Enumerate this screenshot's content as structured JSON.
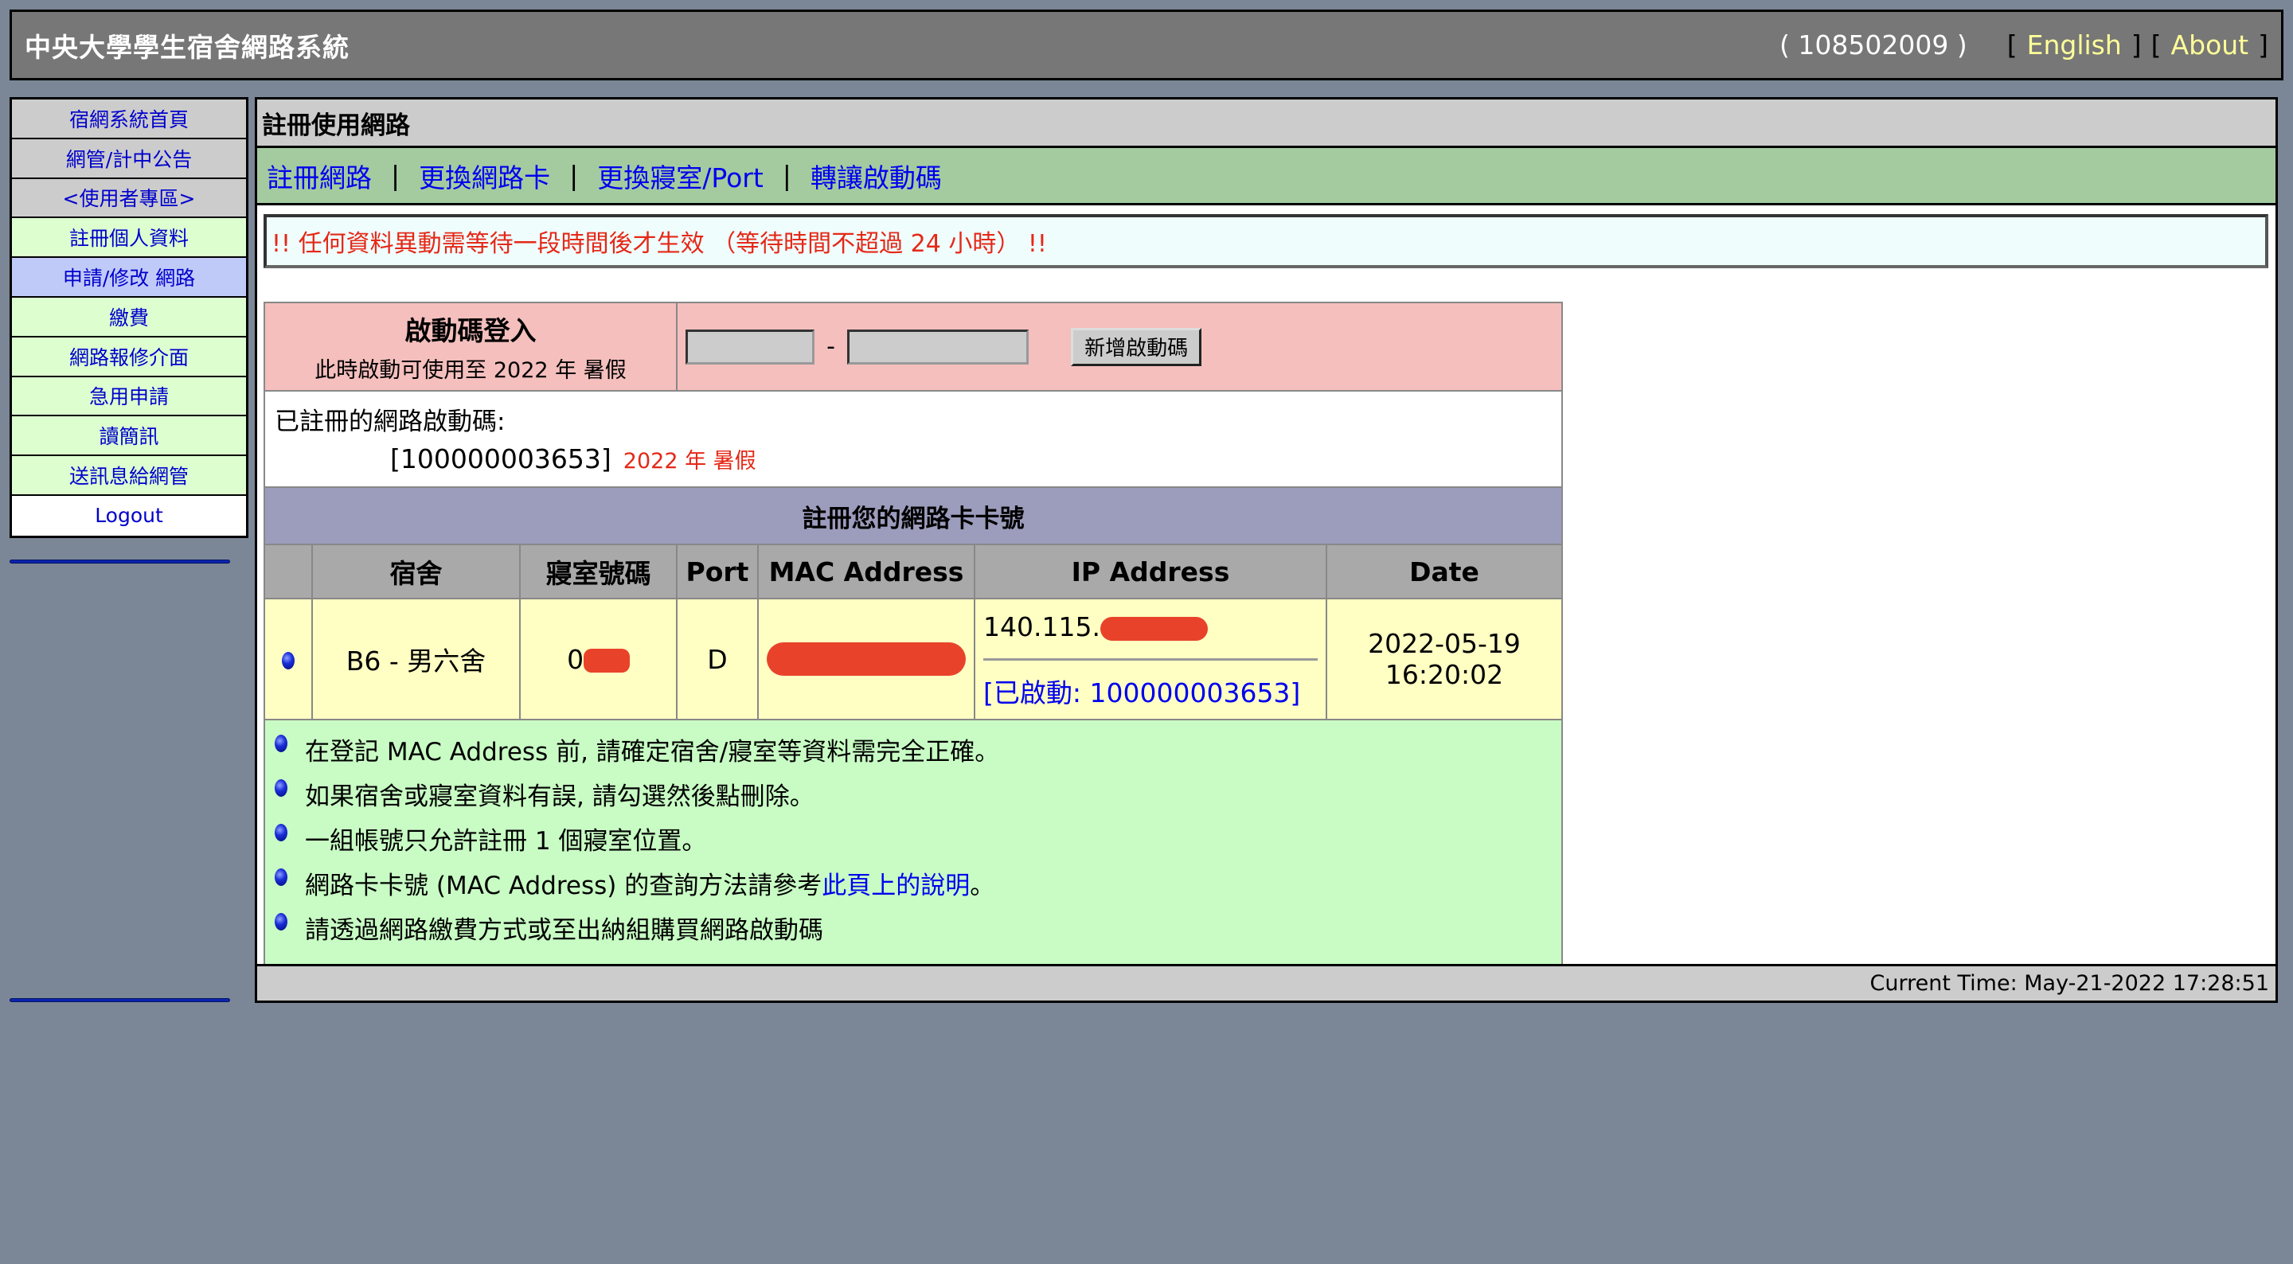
{
  "header": {
    "title": "中央大學學生宿舍網路系統",
    "user_id": "( 108502009 )",
    "links": [
      {
        "label": "English"
      },
      {
        "label": "About"
      }
    ]
  },
  "sidebar": {
    "items": [
      {
        "label": "宿網系統首頁",
        "style": "gray"
      },
      {
        "label": "網管/計中公告",
        "style": "gray"
      },
      {
        "label": "<使用者專區>",
        "style": "gray"
      },
      {
        "label": "註冊個人資料",
        "style": "green"
      },
      {
        "label": "申請/修改 網路",
        "style": "active"
      },
      {
        "label": "繳費",
        "style": "green"
      },
      {
        "label": "網路報修介面",
        "style": "green"
      },
      {
        "label": "急用申請",
        "style": "green"
      },
      {
        "label": "讀簡訊",
        "style": "green"
      },
      {
        "label": "送訊息給網管",
        "style": "green"
      },
      {
        "label": "Logout",
        "style": "white"
      }
    ]
  },
  "main": {
    "title": "註冊使用網路",
    "subnav": [
      {
        "label": "註冊網路"
      },
      {
        "label": "更換網路卡"
      },
      {
        "label": "更換寢室/Port"
      },
      {
        "label": "轉讓啟動碼"
      }
    ],
    "subnav_separator": "|",
    "warning": "!! 任何資料異動需等待一段時間後才生效 （等待時間不超過 24 小時） !!",
    "activation": {
      "heading": "啟動碼登入",
      "subtext": "此時啟動可使用至 2022 年 暑假",
      "input1_value": "",
      "input2_value": "",
      "dash": "-",
      "add_button": "新增啟動碼"
    },
    "registered": {
      "label": "已註冊的網路啟動碼:",
      "code": "[100000003653]",
      "term": "2022 年 暑假"
    },
    "nic_table": {
      "title": "註冊您的網路卡卡號",
      "columns": [
        "",
        "宿舍",
        "寢室號碼",
        "Port",
        "MAC Address",
        "IP Address",
        "Date"
      ],
      "rows": [
        {
          "dorm": "B6 - 男六舍",
          "room": "0",
          "room_redacted": true,
          "port": "D",
          "mac": "",
          "mac_redacted": true,
          "ip": "140.115.",
          "ip_redacted": true,
          "activated": "[已啟動: 100000003653]",
          "date": "2022-05-19 16:20:02"
        }
      ]
    },
    "notes": [
      {
        "text": "在登記 MAC Address 前, 請確定宿舍/寢室等資料需完全正確。"
      },
      {
        "text": "如果宿舍或寢室資料有誤, 請勾選然後點刪除。"
      },
      {
        "text": "一組帳號只允許註冊 1 個寢室位置。"
      },
      {
        "text": "網路卡卡號 (MAC Address) 的查詢方法請參考",
        "link": "此頁上的說明",
        "after": "。"
      },
      {
        "text": "請透過網路繳費方式或至出納組購買網路啟動碼"
      }
    ],
    "footer": "Current Time: May-21-2022 17:28:51"
  },
  "colors": {
    "page_bg": "#7b8796",
    "header_bg": "#777777",
    "link_yellow": "#ffff99",
    "link_blue": "#0000ee",
    "warning_red": "#e52817",
    "subnav_green": "#a4cba0",
    "pink": "#f4bfbd",
    "purple": "#9c9cbc",
    "row_yellow": "#ffffc4",
    "notes_green": "#c8fcc4",
    "redaction": "#e8432a"
  }
}
